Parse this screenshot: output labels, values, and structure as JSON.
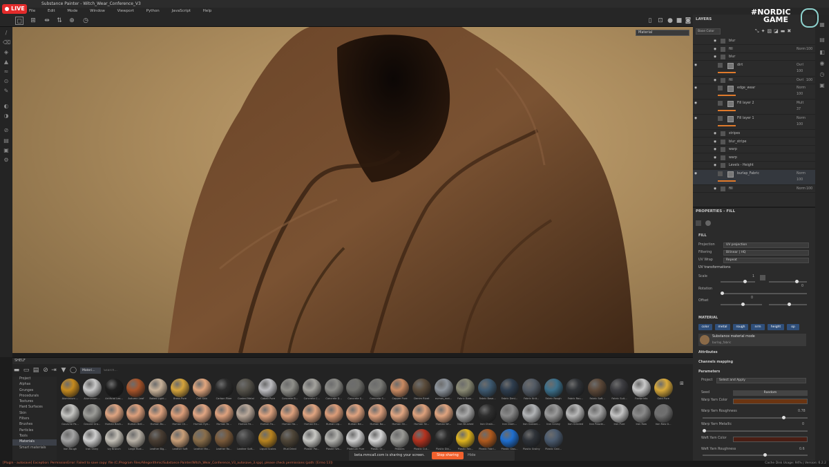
{
  "window": {
    "title": "Substance Painter - Witch_Wear_Conference_V3",
    "live_badge": "LIVE"
  },
  "menu": [
    "File",
    "Edit",
    "Mode",
    "Window",
    "Viewport",
    "Python",
    "JavaScript",
    "Help"
  ],
  "viewport": {
    "display_mode": "Material"
  },
  "logo": {
    "text_line1": "#NORDIC",
    "text_line2": "GAME",
    "accent": "#ffffff"
  },
  "layers": {
    "title": "LAYERS",
    "channel_select": "Base Color",
    "rows": [
      {
        "name": "blur",
        "blend": "",
        "opacity": ""
      },
      {
        "name": "fill",
        "blend": "Norm",
        "opacity": "100"
      },
      {
        "name": "blur",
        "blend": "",
        "opacity": ""
      },
      {
        "name": "dirt",
        "blend": "Ovrl",
        "opacity": "100"
      },
      {
        "name": "fill",
        "blend": "Ovrl",
        "opacity": "100"
      },
      {
        "name": "edge_wear",
        "blend": "Norm",
        "opacity": "100"
      },
      {
        "name": "Fill layer 2",
        "blend": "Mult",
        "opacity": "37"
      },
      {
        "name": "Fill layer 1",
        "blend": "Norm",
        "opacity": "100"
      },
      {
        "name": "stripes",
        "blend": "",
        "opacity": ""
      },
      {
        "name": "blur_stripe",
        "blend": "",
        "opacity": ""
      },
      {
        "name": "warp",
        "blend": "",
        "opacity": ""
      },
      {
        "name": "warp",
        "blend": "",
        "opacity": ""
      },
      {
        "name": "Levels - Height",
        "blend": "",
        "opacity": ""
      },
      {
        "name": "burlap_Fabric",
        "blend": "Norm",
        "opacity": "100"
      },
      {
        "name": "fill",
        "blend": "Norm",
        "opacity": "100"
      }
    ]
  },
  "properties": {
    "title": "PROPERTIES - FILL",
    "fill_header": "FILL",
    "projection_label": "Projection",
    "projection_value": "UV projection",
    "filtering_label": "Filtering",
    "filtering_value": "Bilinear | HQ",
    "uvwrap_label": "UV Wrap",
    "uvwrap_value": "Repeat",
    "uv_transform_header": "UV transformations",
    "scale_label": "Scale",
    "scale_value": "1",
    "rotation_label": "Rotation",
    "rotation_value": "0",
    "offset_label": "Offset",
    "offset_value": "0",
    "material_header": "MATERIAL",
    "channels": [
      "color",
      "metal",
      "rough",
      "nrm",
      "height",
      "op"
    ],
    "material_name": "Substance material mode",
    "material_sub": "burlap_fabric",
    "attributes_header": "Attributes",
    "channels_mapping_header": "Channels mapping",
    "parameters_header": "Parameters",
    "project_label": "Project",
    "project_value": "Select and Apply",
    "seed_label": "Seed",
    "seed_value": "Random",
    "warp_color_label": "Warp Yarn Color",
    "warp_roughness_label": "Warp Yarn Roughness",
    "warp_roughness_value": "0.78",
    "warp_metallic_label": "Warp Yarn Metallic",
    "warp_metallic_value": "0",
    "weft_color_label": "Weft Yarn Color",
    "weft_roughness_label": "Weft Yarn Roughness",
    "weft_roughness_value": "0.6",
    "warp_color": "#6b3512",
    "weft_color": "#4a1e14"
  },
  "shelf": {
    "title": "SHELF",
    "filter_tag": "Materi...",
    "search_placeholder": "Search...",
    "categories": [
      "Project",
      "Alphas",
      "Grunges",
      "Procedurals",
      "Textures",
      "Hard Surfaces",
      "Skin",
      "Filters",
      "Brushes",
      "Particles",
      "Tools",
      "Materials",
      "Smart materials"
    ],
    "selected_category": "Materials",
    "materials": [
      {
        "name": "Aluminium ...",
        "color": "#c58a1f"
      },
      {
        "name": "Aluminium ...",
        "color": "#c9c9c9"
      },
      {
        "name": "Artificial Lea...",
        "color": "#1e1e1e"
      },
      {
        "name": "Autumn Leaf",
        "color": "#a8542a"
      },
      {
        "name": "Baked Light...",
        "color": "#c9b39a"
      },
      {
        "name": "Brass Pure",
        "color": "#d5a43c"
      },
      {
        "name": "Calf Skin",
        "color": "#e1a67e"
      },
      {
        "name": "Carbon Fiber",
        "color": "#2b2b2b"
      },
      {
        "name": "Coated Metal",
        "color": "#55524a"
      },
      {
        "name": "Cobalt Pure",
        "color": "#bcbcc0"
      },
      {
        "name": "Concrete B...",
        "color": "#8f8f8a"
      },
      {
        "name": "Concrete C...",
        "color": "#a4a39e"
      },
      {
        "name": "Concrete D...",
        "color": "#8a8a86"
      },
      {
        "name": "Concrete S...",
        "color": "#6e6e6a"
      },
      {
        "name": "Concrete S...",
        "color": "#7a7a76"
      },
      {
        "name": "Copper Pure",
        "color": "#c98a62"
      },
      {
        "name": "Denim Rivet",
        "color": "#5a4b3a"
      },
      {
        "name": "eumas_mat...",
        "color": "#8d949c"
      },
      {
        "name": "Fabric Bam...",
        "color": "#8a8a74"
      },
      {
        "name": "Fabric Base...",
        "color": "#3d5970"
      },
      {
        "name": "Fabric Deni...",
        "color": "#2e3d4e"
      },
      {
        "name": "Fabric Knit...",
        "color": "#525a64"
      },
      {
        "name": "Fabric Rough",
        "color": "#3b6f8a"
      },
      {
        "name": "Fabric Rou...",
        "color": "#2f3236"
      },
      {
        "name": "Fabric Soft...",
        "color": "#5c4838"
      },
      {
        "name": "Fabric Suit...",
        "color": "#3c3c40"
      },
      {
        "name": "Footprints",
        "color": "#c9c9c9"
      },
      {
        "name": "Gold Pure",
        "color": "#d8a93a"
      },
      {
        "name": "Gouache Pa...",
        "color": "#c5c5c2"
      },
      {
        "name": "Ground Gra...",
        "color": "#9c9c98"
      },
      {
        "name": "Human Back...",
        "color": "#e0a582"
      },
      {
        "name": "Human Bell...",
        "color": "#dea07c"
      },
      {
        "name": "Human Bu...",
        "color": "#e0a480"
      },
      {
        "name": "Human Ch...",
        "color": "#dd9f7a"
      },
      {
        "name": "Human Eye...",
        "color": "#e2a683"
      },
      {
        "name": "Human Fa...",
        "color": "#dfa27e"
      },
      {
        "name": "Human Fe...",
        "color": "#b9a89a"
      },
      {
        "name": "Human Fo...",
        "color": "#e0a480"
      },
      {
        "name": "Human Ha...",
        "color": "#dea17d"
      },
      {
        "name": "Human Kn...",
        "color": "#e1a581"
      },
      {
        "name": "Human Lip...",
        "color": "#dd9d79"
      },
      {
        "name": "Human Ne...",
        "color": "#e0a380"
      },
      {
        "name": "Human No...",
        "color": "#dfa27f"
      },
      {
        "name": "Human Sh...",
        "color": "#e2a682"
      },
      {
        "name": "Human Sk...",
        "color": "#dea17c"
      },
      {
        "name": "Human Wr...",
        "color": "#e0a47f"
      },
      {
        "name": "Iron Brushed",
        "color": "#a9a9a9"
      },
      {
        "name": "Iron Chain...",
        "color": "#2e2e2e"
      },
      {
        "name": "Iron Diam...",
        "color": "#8a8a8a"
      },
      {
        "name": "Iron Galvani...",
        "color": "#b2b4b6"
      },
      {
        "name": "Iron Grainy",
        "color": "#9a9a9a"
      },
      {
        "name": "Iron Grinded",
        "color": "#b8b8b8"
      },
      {
        "name": "Iron Powde...",
        "color": "#a6a6a6"
      },
      {
        "name": "Iron Pure",
        "color": "#c4c4c4"
      },
      {
        "name": "Iron Raw",
        "color": "#8a8a8a"
      },
      {
        "name": "Iron Raw D...",
        "color": "#707070"
      },
      {
        "name": "Iron Rough",
        "color": "#a4a4a4"
      },
      {
        "name": "Iron Shiny",
        "color": "#cfcfcf"
      },
      {
        "name": "Ivy Branch",
        "color": "#c5c1b8"
      },
      {
        "name": "Large Rust...",
        "color": "#bab3a8"
      },
      {
        "name": "Leather Big...",
        "color": "#4a3e33"
      },
      {
        "name": "Leather Soft",
        "color": "#c99f78"
      },
      {
        "name": "Leather Ma...",
        "color": "#8a6e4a"
      },
      {
        "name": "Leather Ro...",
        "color": "#7a5a3a"
      },
      {
        "name": "Leather Soft...",
        "color": "#3f3f3f"
      },
      {
        "name": "Liquid Scales",
        "color": "#b88420"
      },
      {
        "name": "Mud Dried",
        "color": "#4f4638"
      },
      {
        "name": "Plaster Pai...",
        "color": "#c8c8c4"
      },
      {
        "name": "Plaster Wh...",
        "color": "#b4b4b0"
      },
      {
        "name": "Platinum Pure",
        "color": "#d0d0d0"
      },
      {
        "name": "Plastic Gr...",
        "color": "#d6d6d6"
      },
      {
        "name": "Pebbles",
        "color": "#9a9a96"
      },
      {
        "name": "Plastic Cut...",
        "color": "#b3321f"
      },
      {
        "name": "Plastic Dia...",
        "color": "#2a2a2a"
      },
      {
        "name": "Plastic Fab...",
        "color": "#e0b41e"
      },
      {
        "name": "Plastic Fabri...",
        "color": "#b05a1e"
      },
      {
        "name": "Plastic Glos...",
        "color": "#1f6fd0"
      },
      {
        "name": "Plastic Grainy",
        "color": "#2e3238"
      },
      {
        "name": "Plastic Grid...",
        "color": "#4a5a6e"
      }
    ]
  },
  "share": {
    "text": "beta.mmcall.com is sharing your screen.",
    "stop_label": "Stop sharing",
    "hide_label": "Hide"
  },
  "status": {
    "left": "[Plugin - autosave] Exception: PermissionError: Failed to save copy: file (C:/Program Files/Allegorithmic/Substance Painter/Witch_Wear_Conference_V3_autosave_3.spp), please check permissions (path: [Errno 13])",
    "right": "Cache Disk Usage:  94% | Version: 6.2.2"
  }
}
